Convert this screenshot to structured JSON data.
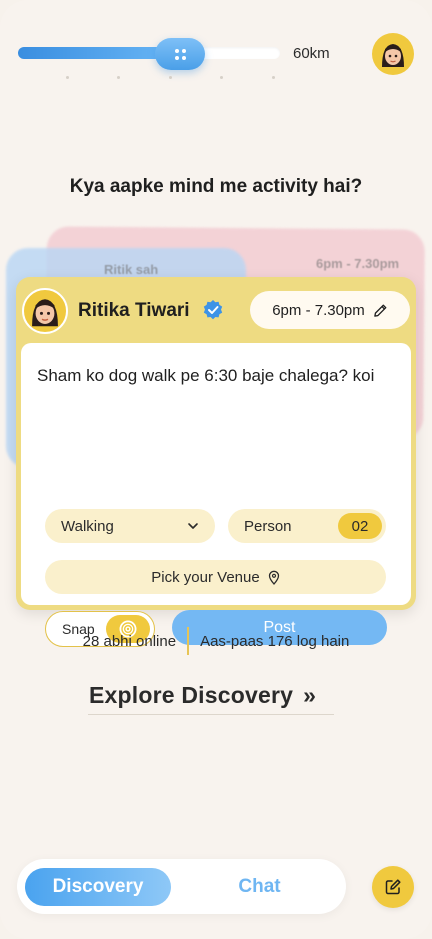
{
  "header": {
    "distance_label": "60km",
    "distance_progress": 0.62
  },
  "headline": "Kya aapke mind me activity hai?",
  "background_cards": {
    "name": "Ritik sah",
    "time": "6pm - 7.30pm"
  },
  "card": {
    "user_name": "Ritika Tiwari",
    "time_range": "6pm - 7.30pm",
    "post_text": "Sham ko dog walk pe 6:30 baje chalega? koi",
    "activity": "Walking",
    "person_label": "Person",
    "person_count": "02",
    "venue_label": "Pick your Venue",
    "snap_label": "Snap",
    "post_button": "Post"
  },
  "stats": {
    "online": "28 abhi online",
    "nearby": "Aas-paas 176 log hain"
  },
  "explore": {
    "label": "Explore Discovery",
    "arrow": "»"
  },
  "nav": {
    "tabs": [
      {
        "label": "Discovery",
        "active": true
      },
      {
        "label": "Chat",
        "active": false
      }
    ]
  },
  "colors": {
    "accent_blue": "#74b8f3",
    "accent_yellow": "#f0c93e",
    "card_yellow": "#eedb82",
    "background": "#f8f3ee"
  },
  "icons": {
    "slider_thumb": "grip-dots-icon",
    "verified": "verified-badge-icon",
    "edit": "pencil-icon",
    "dropdown": "chevron-down-icon",
    "venue": "location-pin-icon",
    "snap": "target-icon",
    "compose": "edit-square-icon"
  }
}
